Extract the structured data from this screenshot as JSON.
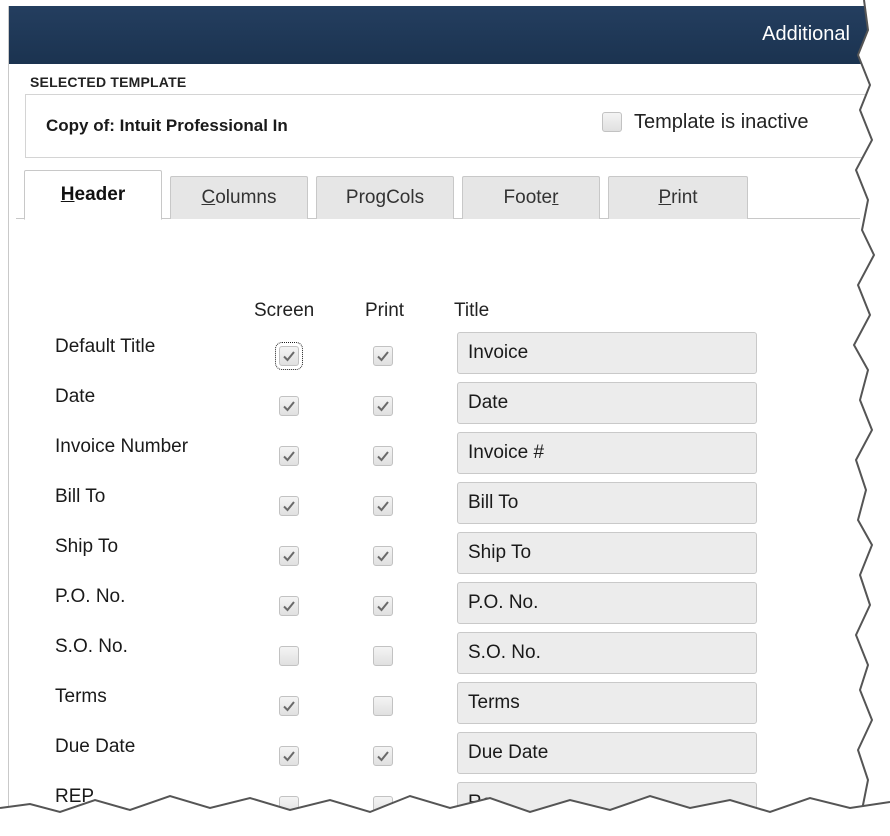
{
  "window": {
    "title": "Additional"
  },
  "selected_template": {
    "legend": "SELECTED TEMPLATE",
    "name": "Copy of: Intuit Professional In",
    "inactive_label": "Template is inactive",
    "inactive_checked": false
  },
  "tabs": [
    {
      "label_pre": "",
      "label_u": "H",
      "label_post": "eader",
      "active": true
    },
    {
      "label_pre": "",
      "label_u": "C",
      "label_post": "olumns",
      "active": false
    },
    {
      "label_pre": "Pro",
      "label_u": "g",
      "label_post": " Cols",
      "active": false
    },
    {
      "label_pre": "Foote",
      "label_u": "r",
      "label_post": "",
      "active": false
    },
    {
      "label_pre": "",
      "label_u": "P",
      "label_post": "rint",
      "active": false
    }
  ],
  "columns": {
    "screen": "Screen",
    "print": "Print",
    "title": "Title"
  },
  "rows": [
    {
      "label": "Default Title",
      "screen": true,
      "print": true,
      "title": "Invoice"
    },
    {
      "label": "Date",
      "screen": true,
      "print": true,
      "title": "Date"
    },
    {
      "label": "Invoice Number",
      "screen": true,
      "print": true,
      "title": "Invoice #"
    },
    {
      "label": "Bill To",
      "screen": true,
      "print": true,
      "title": "Bill To"
    },
    {
      "label": "Ship To",
      "screen": true,
      "print": true,
      "title": "Ship To"
    },
    {
      "label": "P.O. No.",
      "screen": true,
      "print": true,
      "title": "P.O. No."
    },
    {
      "label": "S.O. No.",
      "screen": false,
      "print": false,
      "title": "S.O. No."
    },
    {
      "label": "Terms",
      "screen": true,
      "print": false,
      "title": "Terms"
    },
    {
      "label": "Due Date",
      "screen": true,
      "print": true,
      "title": "Due Date"
    },
    {
      "label": "REP",
      "screen": false,
      "print": false,
      "title": "Re"
    }
  ],
  "colors": {
    "titlebar": "#1f3856",
    "tab_inactive": "#e6e6e6",
    "field_bg": "#ececec"
  }
}
